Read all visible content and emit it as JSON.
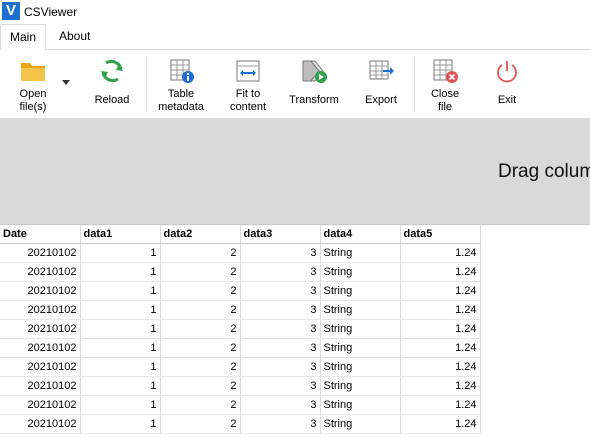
{
  "app": {
    "title": "CSViewer",
    "logo_letter": "V"
  },
  "tabs": [
    {
      "label": "Main",
      "active": true
    },
    {
      "label": "About",
      "active": false
    }
  ],
  "ribbon": {
    "open": [
      "Open",
      "file(s)"
    ],
    "reload": "Reload",
    "table_metadata": [
      "Table",
      "metadata"
    ],
    "fit_to_content": [
      "Fit to",
      "content"
    ],
    "transform": "Transform",
    "export": "Export",
    "close_file": [
      "Close",
      "file"
    ],
    "exit": "Exit"
  },
  "drag_hint": "Drag column header here to group by that column",
  "table": {
    "columns": [
      "Date",
      "data1",
      "data2",
      "data3",
      "data4",
      "data5"
    ],
    "rows": [
      [
        "20210102",
        "1",
        "2",
        "3",
        "String",
        "1.24"
      ],
      [
        "20210102",
        "1",
        "2",
        "3",
        "String",
        "1.24"
      ],
      [
        "20210102",
        "1",
        "2",
        "3",
        "String",
        "1.24"
      ],
      [
        "20210102",
        "1",
        "2",
        "3",
        "String",
        "1.24"
      ],
      [
        "20210102",
        "1",
        "2",
        "3",
        "String",
        "1.24"
      ],
      [
        "20210102",
        "1",
        "2",
        "3",
        "String",
        "1.24"
      ],
      [
        "20210102",
        "1",
        "2",
        "3",
        "String",
        "1.24"
      ],
      [
        "20210102",
        "1",
        "2",
        "3",
        "String",
        "1.24"
      ],
      [
        "20210102",
        "1",
        "2",
        "3",
        "String",
        "1.24"
      ],
      [
        "20210102",
        "1",
        "2",
        "3",
        "String",
        "1.24"
      ]
    ]
  },
  "colors": {
    "accent_blue": "#1e6fd0",
    "folder": "#f2b428",
    "reload_green": "#2fa24a",
    "exit_red": "#e05252",
    "dragzone_bg": "#d9d9d9"
  }
}
